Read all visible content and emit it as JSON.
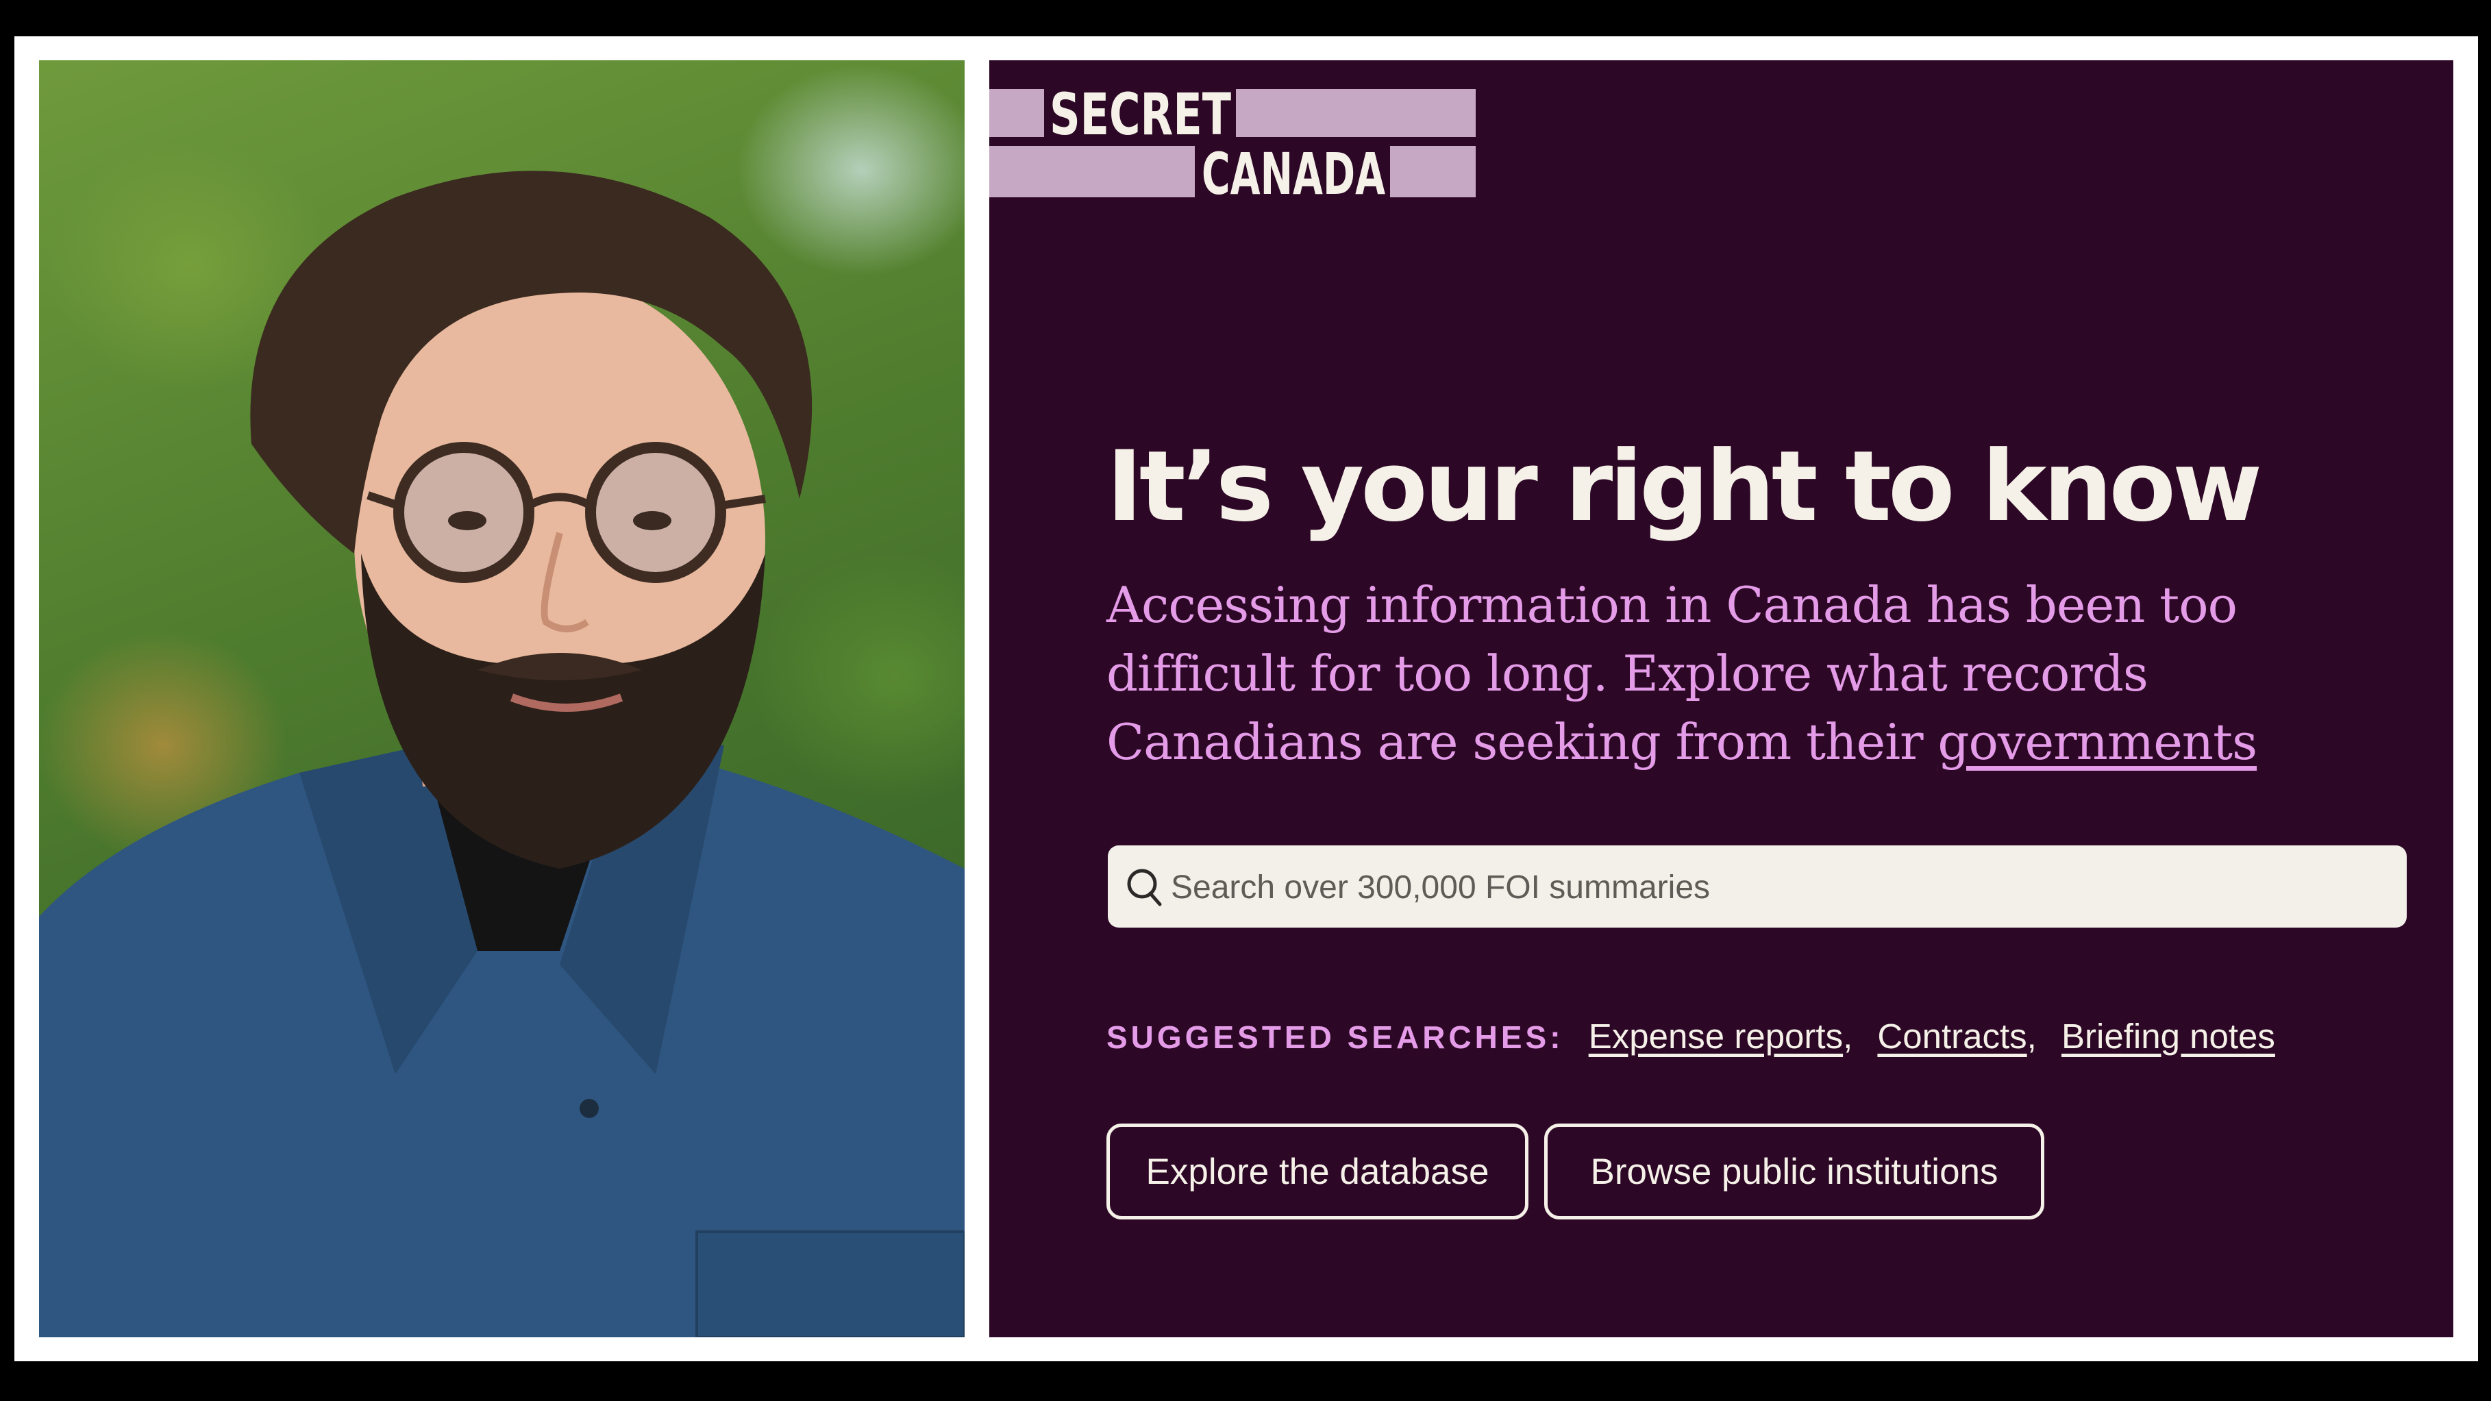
{
  "photo": {
    "description_icon": "portrait-photo"
  },
  "site": {
    "logo": {
      "line1": "SECRET",
      "line2": "CANADA"
    },
    "headline": "It’s your right to know",
    "lede_text": "Accessing information in Canada has been too difficult for too long. Explore what records Canadians are seeking from their ",
    "lede_link": "governments",
    "search": {
      "placeholder": "Search over 300,000 FOI summaries",
      "icon": "search-icon"
    },
    "suggested": {
      "label": "SUGGESTED SEARCHES:",
      "items": [
        {
          "label": "Expense reports",
          "sep": ","
        },
        {
          "label": "Contracts",
          "sep": ","
        },
        {
          "label": "Briefing notes",
          "sep": ""
        }
      ]
    },
    "buttons": {
      "explore": "Explore the database",
      "browse": "Browse public institutions"
    }
  },
  "colors": {
    "background": "#2c0826",
    "accent_pink": "#e59ce8",
    "cream": "#f6f1e8",
    "logo_bar": "#c7a8c4"
  }
}
